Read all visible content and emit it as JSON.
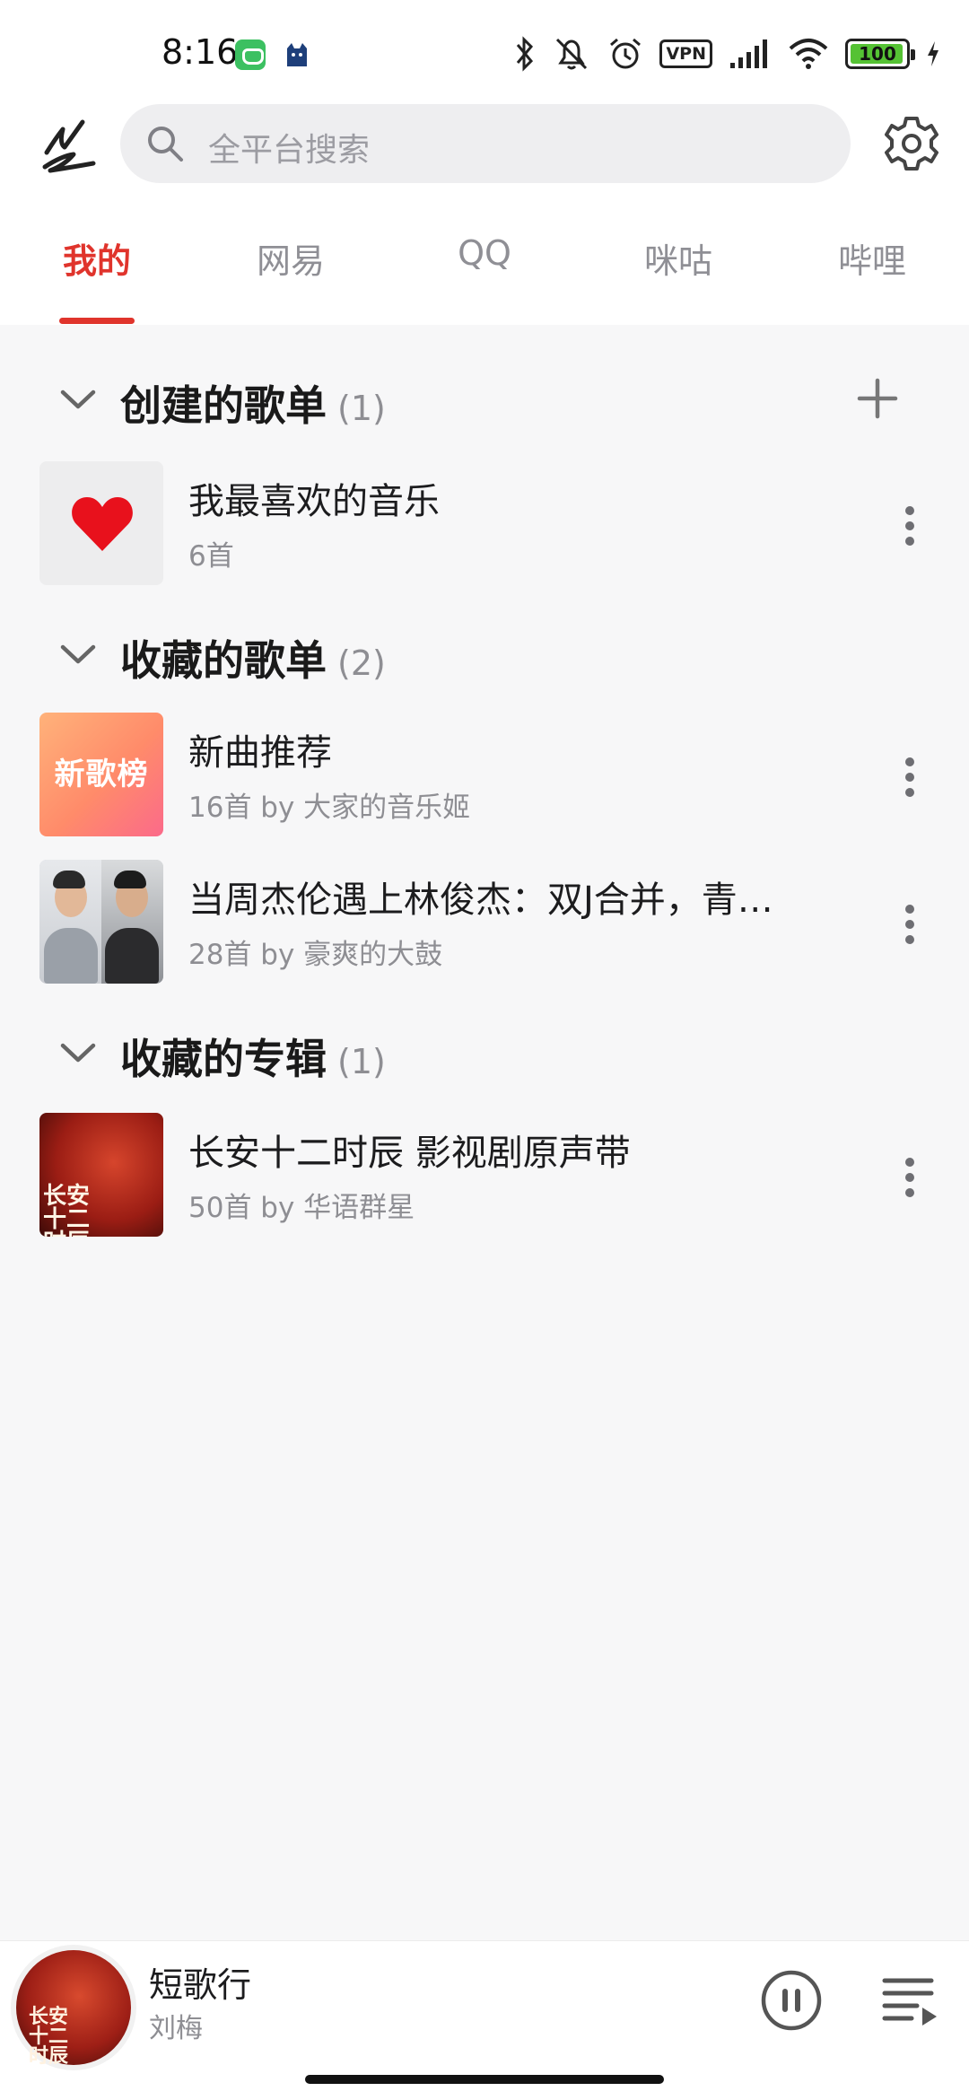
{
  "status_bar": {
    "time": "8:16",
    "vpn_label": "VPN",
    "battery_level": "100",
    "battery_color": "#55c234"
  },
  "header": {
    "logo_icon": "app-logo-icon",
    "search_placeholder": "全平台搜索",
    "settings_icon": "gear-icon"
  },
  "tabs": {
    "items": [
      {
        "label": "我的"
      },
      {
        "label": "网易"
      },
      {
        "label": "QQ"
      },
      {
        "label": "咪咕"
      },
      {
        "label": "哔哩"
      }
    ],
    "active_index": 0,
    "accent_color": "#e0342c"
  },
  "sections": [
    {
      "title": "创建的歌单",
      "count": "(1)",
      "items": [
        {
          "title": "我最喜欢的音乐",
          "subtitle": "6首"
        }
      ]
    },
    {
      "title": "收藏的歌单",
      "count": "(2)",
      "items": [
        {
          "title": "新曲推荐",
          "subtitle": "16首 by 大家的音乐姬",
          "cover_text": "新歌榜"
        },
        {
          "title": "当周杰伦遇上林俊杰：双J合并，青…",
          "subtitle": "28首 by 豪爽的大鼓"
        }
      ]
    },
    {
      "title": "收藏的专辑",
      "count": "(1)",
      "items": [
        {
          "title": "长安十二时辰 影视剧原声带",
          "subtitle": "50首 by 华语群星",
          "cover_text": "长安十二时辰"
        }
      ]
    }
  ],
  "player": {
    "title": "短歌行",
    "artist": "刘梅",
    "disc_text": "长安十二时辰"
  }
}
